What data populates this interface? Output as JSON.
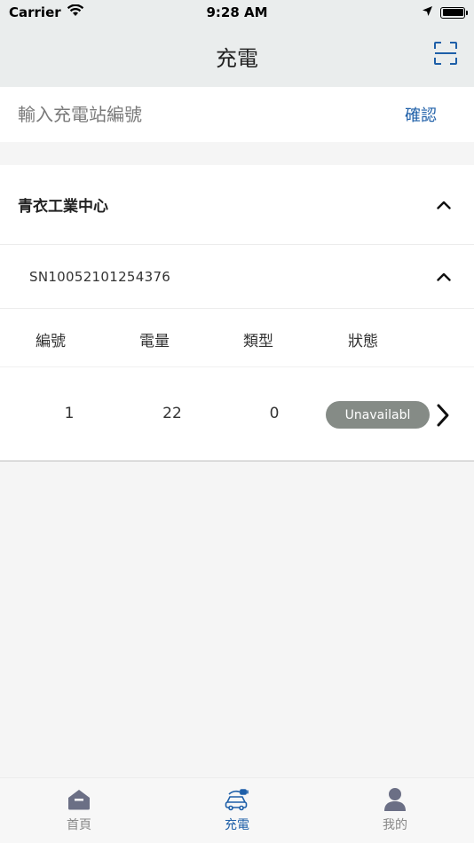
{
  "status_bar": {
    "carrier": "Carrier",
    "time": "9:28 AM"
  },
  "nav": {
    "title": "充電",
    "scan_icon": "qr-scan-icon"
  },
  "search": {
    "placeholder": "輸入充電站編號",
    "value": "",
    "confirm_label": "確認"
  },
  "station": {
    "name": "青衣工業中心",
    "expanded": true,
    "charger": {
      "serial": "SN10052101254376",
      "expanded": true,
      "columns": [
        "編號",
        "電量",
        "類型",
        "狀態"
      ],
      "rows": [
        {
          "id": "1",
          "power": "22",
          "type": "0",
          "status": "Unavailabl"
        }
      ]
    }
  },
  "tabs": [
    {
      "label": "首頁",
      "icon": "home-icon",
      "active": false
    },
    {
      "label": "充電",
      "icon": "ev-charging-icon",
      "active": true
    },
    {
      "label": "我的",
      "icon": "user-icon",
      "active": false
    }
  ],
  "colors": {
    "accent": "#1e5fa8",
    "header_bg": "#eaeded",
    "badge_bg": "#858b86",
    "inactive_tab": "#888888"
  }
}
